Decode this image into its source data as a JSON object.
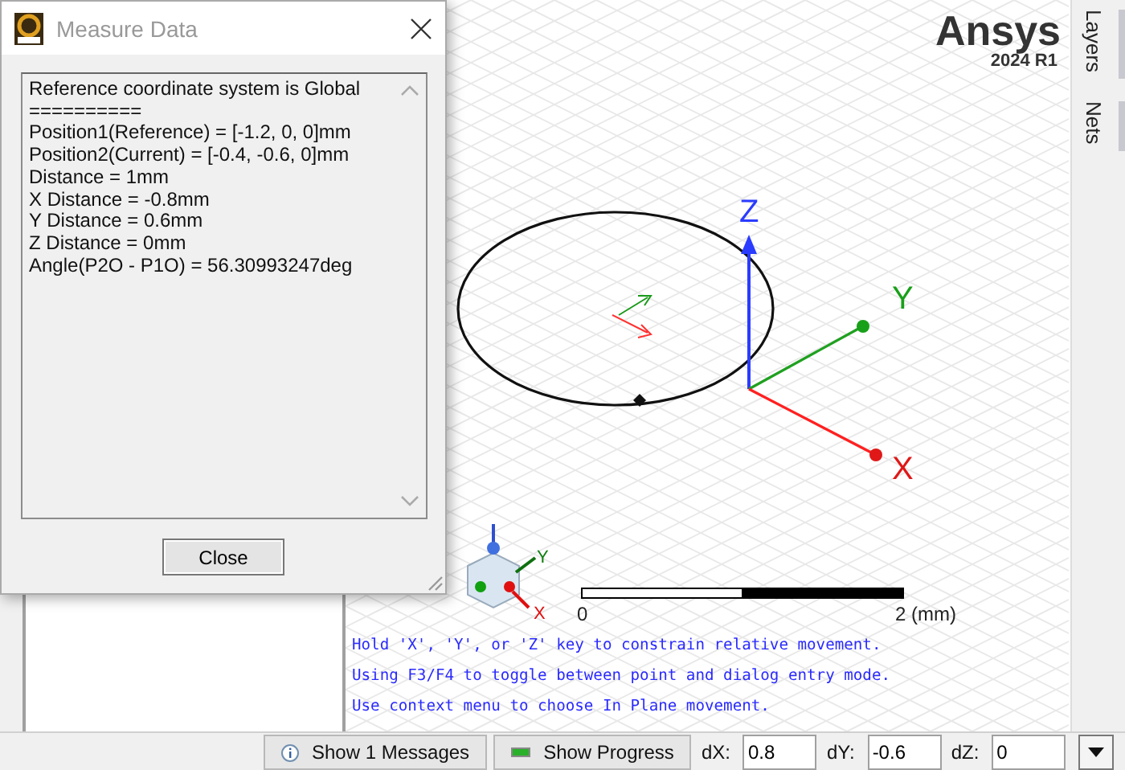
{
  "measure_dialog": {
    "title": "Measure Data",
    "lines": [
      "Reference coordinate system is Global",
      "==========",
      "Position1(Reference) = [-1.2, 0, 0]mm",
      "Position2(Current) = [-0.4, -0.6, 0]mm",
      "Distance = 1mm",
      "X Distance = -0.8mm",
      "Y Distance = 0.6mm",
      "Z Distance = 0mm",
      "Angle(P2O - P1O) = 56.30993247deg"
    ],
    "close_button": "Close"
  },
  "viewport": {
    "logo": {
      "name": "Ansys",
      "version": "2024 R1"
    },
    "axis_labels": {
      "x": "X",
      "y": "Y",
      "z": "Z"
    },
    "triad_labels": {
      "y": "Y",
      "x": "X"
    },
    "scale_labels": [
      "0",
      "2 (mm)"
    ],
    "messages": [
      "Hold 'X', 'Y', or 'Z' key to constrain relative movement.",
      "Using F3/F4 to toggle between point and dialog entry mode.",
      "Use context menu to choose In Plane movement."
    ]
  },
  "side_tabs": [
    {
      "label": "Layers",
      "selected": false
    },
    {
      "label": "Nets",
      "selected": false
    }
  ],
  "status_bar": {
    "messages_button": "Show 1 Messages",
    "progress_button": "Show Progress",
    "fields": [
      {
        "label": "dX:",
        "value": "0.8"
      },
      {
        "label": "dY:",
        "value": "-0.6"
      },
      {
        "label": "dZ:",
        "value": "0"
      }
    ]
  }
}
